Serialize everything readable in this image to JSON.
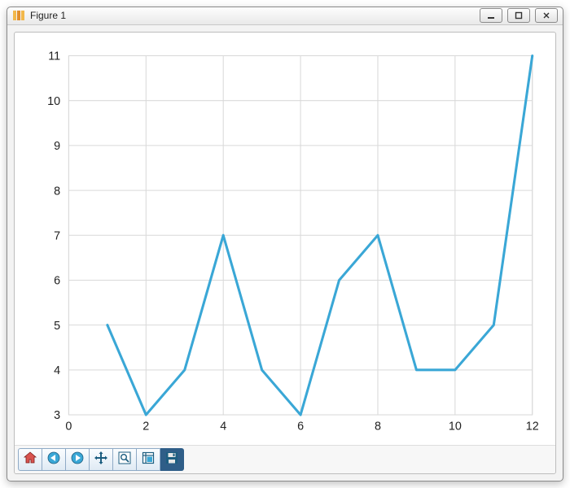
{
  "window": {
    "title": "Figure 1"
  },
  "chart_data": {
    "type": "line",
    "x": [
      1,
      2,
      3,
      4,
      5,
      6,
      7,
      8,
      9,
      10,
      11,
      12
    ],
    "y": [
      5,
      3,
      4,
      7,
      4,
      3,
      6,
      7,
      4,
      4,
      5,
      11
    ],
    "xlim": [
      0,
      12
    ],
    "ylim": [
      3,
      11
    ],
    "xticks": [
      0,
      2,
      4,
      6,
      8,
      10,
      12
    ],
    "yticks": [
      3,
      4,
      5,
      6,
      7,
      8,
      9,
      10,
      11
    ],
    "line_color": "#3aa7d6",
    "grid": true
  },
  "toolbar": {
    "items": [
      {
        "name": "home",
        "label": "Home"
      },
      {
        "name": "back",
        "label": "Back"
      },
      {
        "name": "forward",
        "label": "Forward"
      },
      {
        "name": "pan",
        "label": "Pan"
      },
      {
        "name": "zoom",
        "label": "Zoom"
      },
      {
        "name": "subplots",
        "label": "Configure subplots"
      },
      {
        "name": "save",
        "label": "Save"
      }
    ]
  }
}
